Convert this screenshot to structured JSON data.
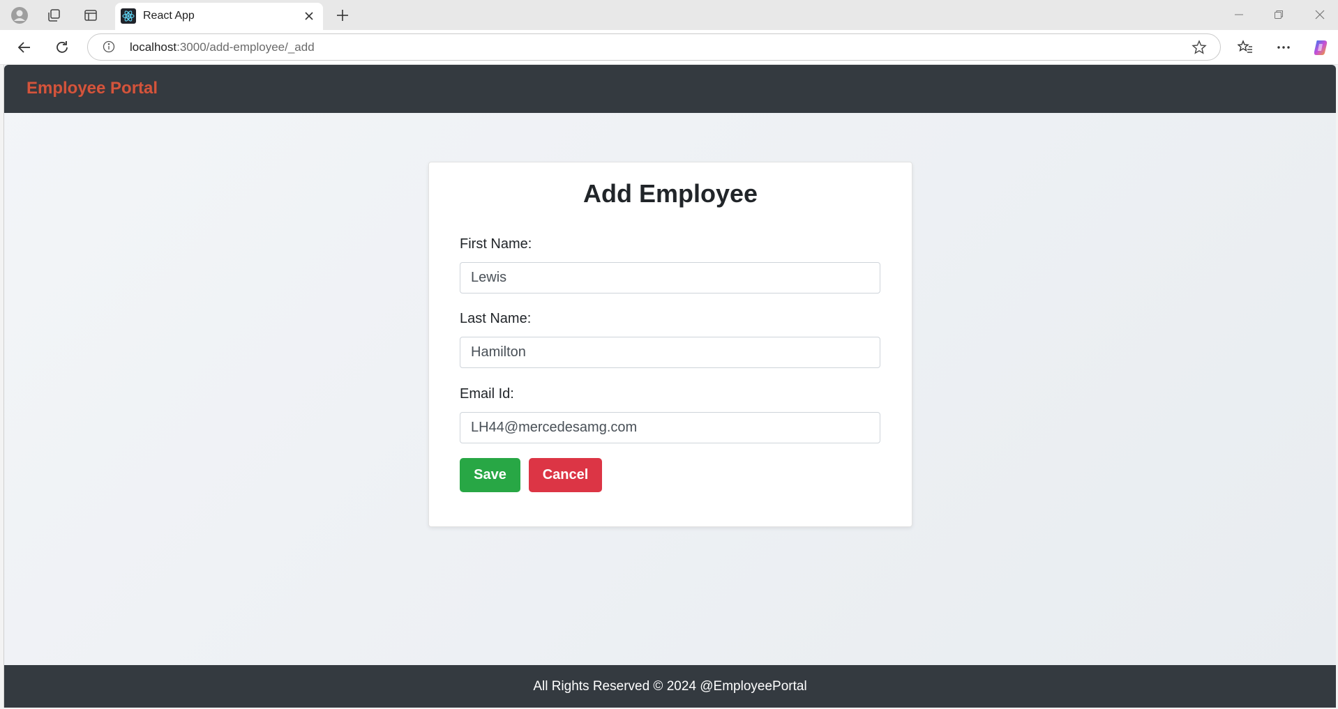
{
  "browser": {
    "tab_title": "React App",
    "url_host": "localhost",
    "url_path": ":3000/add-employee/_add"
  },
  "navbar": {
    "brand": "Employee Portal"
  },
  "form": {
    "title": "Add Employee",
    "first_name_label": "First Name:",
    "first_name_value": "Lewis",
    "last_name_label": "Last Name:",
    "last_name_value": "Hamilton",
    "email_label": "Email Id:",
    "email_value": "LH44@mercedesamg.com",
    "save_label": "Save",
    "cancel_label": "Cancel"
  },
  "footer": {
    "text": "All Rights Reserved © 2024 @EmployeePortal"
  },
  "colors": {
    "navbar_bg": "#343a40",
    "brand": "#d2553d",
    "save": "#28a745",
    "cancel": "#dc3545"
  }
}
